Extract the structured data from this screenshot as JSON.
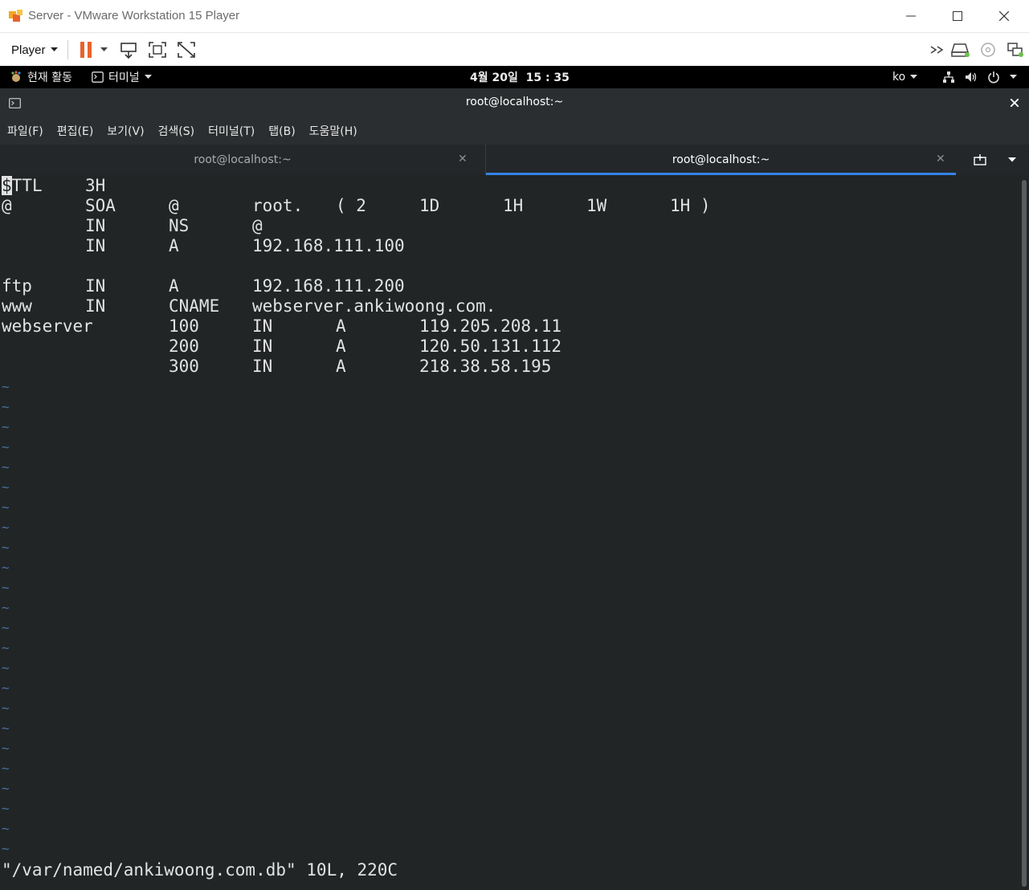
{
  "window": {
    "title": "Server - VMware Workstation 15 Player"
  },
  "vm_toolbar": {
    "player_label": "Player"
  },
  "gnome": {
    "activities": "현재 활동",
    "app_menu": "터미널",
    "clock": "4월 20일  15 : 35",
    "input_lang": "ko"
  },
  "terminal": {
    "window_title": "root@localhost:~",
    "menu": [
      "파일(F)",
      "편집(E)",
      "보기(V)",
      "검색(S)",
      "터미널(T)",
      "탭(B)",
      "도움말(H)"
    ],
    "tabs": [
      {
        "label": "root@localhost:~",
        "active": false
      },
      {
        "label": "root@localhost:~",
        "active": true
      }
    ],
    "lines": [
      [
        {
          "c": 0,
          "t": "$TTL"
        },
        {
          "c": 8,
          "t": "3H"
        }
      ],
      [
        {
          "c": 0,
          "t": "@"
        },
        {
          "c": 8,
          "t": "SOA"
        },
        {
          "c": 16,
          "t": "@"
        },
        {
          "c": 24,
          "t": "root."
        },
        {
          "c": 32,
          "t": "( 2"
        },
        {
          "c": 40,
          "t": "1D"
        },
        {
          "c": 48,
          "t": "1H"
        },
        {
          "c": 56,
          "t": "1W"
        },
        {
          "c": 64,
          "t": "1H )"
        }
      ],
      [
        {
          "c": 8,
          "t": "IN"
        },
        {
          "c": 16,
          "t": "NS"
        },
        {
          "c": 24,
          "t": "@"
        }
      ],
      [
        {
          "c": 8,
          "t": "IN"
        },
        {
          "c": 16,
          "t": "A"
        },
        {
          "c": 24,
          "t": "192.168.111.100"
        }
      ],
      [],
      [
        {
          "c": 0,
          "t": "ftp"
        },
        {
          "c": 8,
          "t": "IN"
        },
        {
          "c": 16,
          "t": "A"
        },
        {
          "c": 24,
          "t": "192.168.111.200"
        }
      ],
      [
        {
          "c": 0,
          "t": "www"
        },
        {
          "c": 8,
          "t": "IN"
        },
        {
          "c": 16,
          "t": "CNAME"
        },
        {
          "c": 24,
          "t": "webserver.ankiwoong.com."
        }
      ],
      [
        {
          "c": 0,
          "t": "webserver"
        },
        {
          "c": 16,
          "t": "100"
        },
        {
          "c": 24,
          "t": "IN"
        },
        {
          "c": 32,
          "t": "A"
        },
        {
          "c": 40,
          "t": "119.205.208.11"
        }
      ],
      [
        {
          "c": 16,
          "t": "200"
        },
        {
          "c": 24,
          "t": "IN"
        },
        {
          "c": 32,
          "t": "A"
        },
        {
          "c": 40,
          "t": "120.50.131.112"
        }
      ],
      [
        {
          "c": 16,
          "t": "300"
        },
        {
          "c": 24,
          "t": "IN"
        },
        {
          "c": 32,
          "t": "A"
        },
        {
          "c": 40,
          "t": "218.38.58.195"
        }
      ]
    ],
    "empty_line_marker": "~",
    "empty_line_count": 24,
    "status_line": "\"/var/named/ankiwoong.com.db\" 10L, 220C"
  },
  "colors": {
    "terminal_bg": "#212526",
    "terminal_fg": "#e2e2e2",
    "tilde": "#4a6f9e",
    "tab_accent": "#3584e4",
    "pause_icon": "#e8632c"
  }
}
